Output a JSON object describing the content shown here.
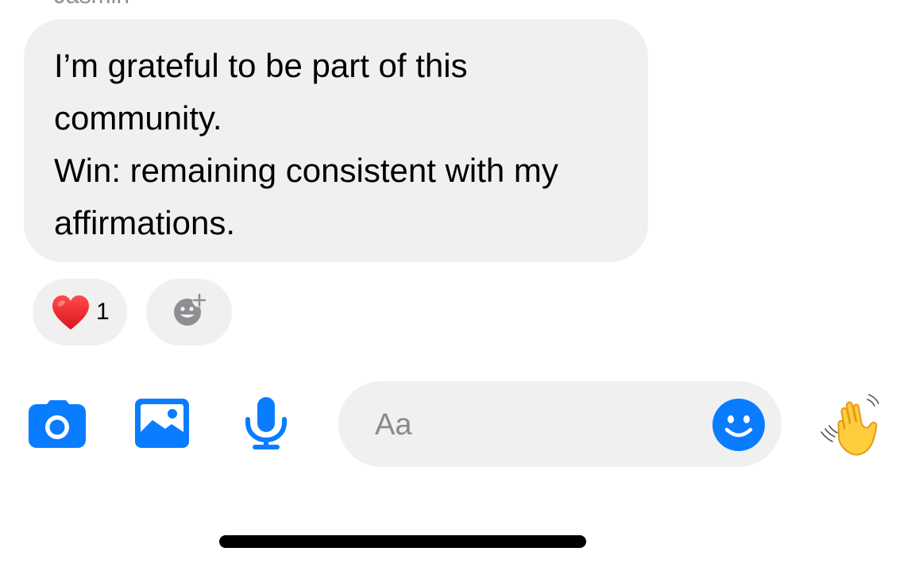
{
  "message": {
    "sender": "Jasmin",
    "lines": [
      "I’m grateful to be part of this",
      "community.",
      "Win: remaining consistent with my",
      "affirmations."
    ]
  },
  "reactions": {
    "emoji": "heart",
    "count": "1",
    "add_icon": "add-reaction-icon"
  },
  "composer": {
    "placeholder": "Aa",
    "value": ""
  },
  "toolbar": {
    "icons": [
      "camera-icon",
      "photo-icon",
      "microphone-icon",
      "emoji-icon",
      "wave-icon"
    ]
  },
  "colors": {
    "accent": "#0a7cff",
    "bubble": "#f0f0f0",
    "text": "#000000",
    "placeholder": "#8a8a8e"
  }
}
